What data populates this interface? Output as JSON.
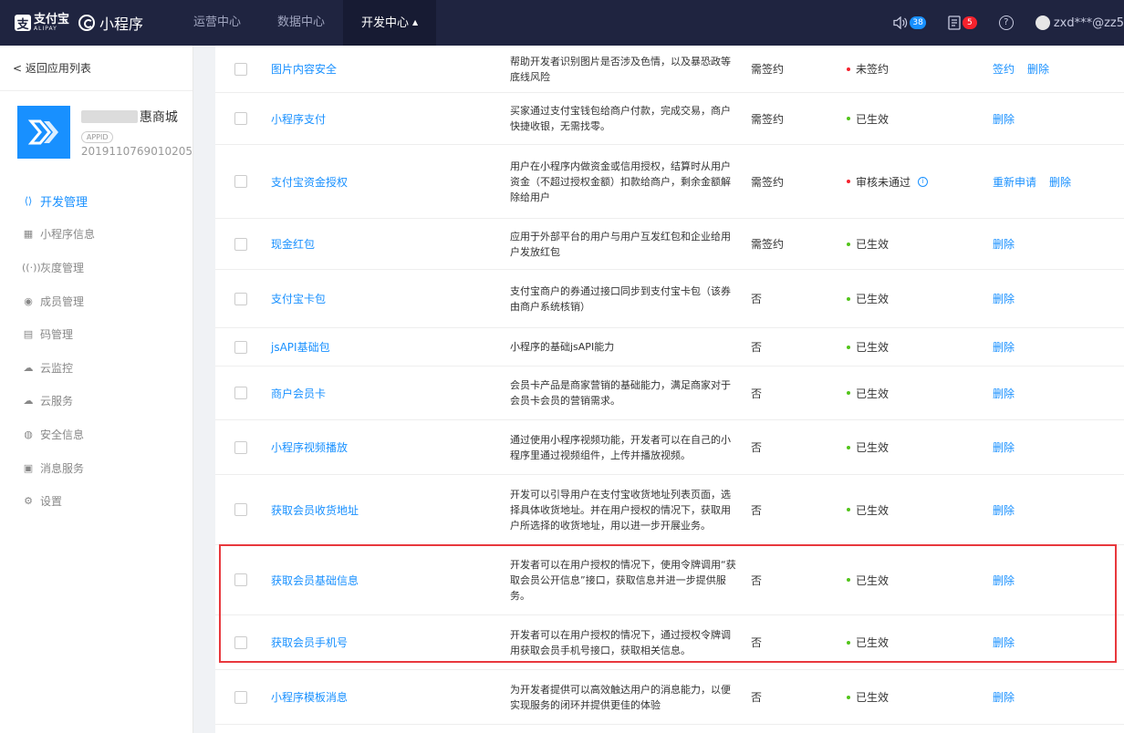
{
  "topnav": {
    "alipay_cn": "支付宝",
    "alipay_en": "ALIPAY",
    "alipay_mark": "支",
    "product": "小程序",
    "tabs": [
      {
        "label": "运营中心"
      },
      {
        "label": "数据中心"
      },
      {
        "label": "开发中心"
      }
    ],
    "active_tab_caret": "▲",
    "notifications_badge": "38",
    "messages_badge": "5",
    "help_glyph": "?",
    "user": "zxd***@zz5"
  },
  "sidebar": {
    "back": "< 返回应用列表",
    "app_name_suffix": "惠商城",
    "appid_tag": "APPID",
    "app_id": "2019110769010205",
    "menu": [
      {
        "label": "开发管理",
        "icon": "code-icon",
        "glyph": "⟨⟩"
      },
      {
        "label": "小程序信息",
        "icon": "grid-icon",
        "glyph": "▦"
      },
      {
        "label": "灰度管理",
        "icon": "signal-icon",
        "glyph": "((·))"
      },
      {
        "label": "成员管理",
        "icon": "user-icon",
        "glyph": "◉"
      },
      {
        "label": "码管理",
        "icon": "qrcode-icon",
        "glyph": "▤"
      },
      {
        "label": "云监控",
        "icon": "cloud-icon",
        "glyph": "☁"
      },
      {
        "label": "云服务",
        "icon": "cloud-service-icon",
        "glyph": "☁"
      },
      {
        "label": "安全信息",
        "icon": "shield-icon",
        "glyph": "◍"
      },
      {
        "label": "消息服务",
        "icon": "message-icon",
        "glyph": "▣"
      },
      {
        "label": "设置",
        "icon": "gear-icon",
        "glyph": "⚙"
      }
    ]
  },
  "table": {
    "rows": [
      {
        "name": "图片内容安全",
        "desc": "帮助开发者识别图片是否涉及色情，以及暴恐政等底线风险",
        "sign": "需签约",
        "status": "未签约",
        "status_color": "#f5222d",
        "actions": [
          "签约",
          "删除"
        ]
      },
      {
        "name": "小程序支付",
        "desc": "买家通过支付宝钱包给商户付款，完成交易，商户快捷收银，无需找零。",
        "sign": "需签约",
        "status": "已生效",
        "status_color": "#52c41a",
        "actions": [
          "删除"
        ]
      },
      {
        "name": "支付宝资金授权",
        "desc": "用户在小程序内做资金或信用授权，结算时从用户资金（不超过授权金额）扣款给商户，剩余金额解除给用户",
        "sign": "需签约",
        "status": "审核未通过",
        "status_color": "#f5222d",
        "info_glyph": "i",
        "actions": [
          "重新申请",
          "删除"
        ]
      },
      {
        "name": "现金红包",
        "desc": "应用于外部平台的用户与用户互发红包和企业给用户发放红包",
        "sign": "需签约",
        "status": "已生效",
        "status_color": "#52c41a",
        "actions": [
          "删除"
        ]
      },
      {
        "name": "支付宝卡包",
        "desc": "支付宝商户的券通过接口同步到支付宝卡包（该券由商户系统核销）",
        "sign": "否",
        "status": "已生效",
        "status_color": "#52c41a",
        "actions": [
          "删除"
        ]
      },
      {
        "name": "jsAPI基础包",
        "desc": "小程序的基础jsAPI能力",
        "sign": "否",
        "status": "已生效",
        "status_color": "#52c41a",
        "actions": [
          "删除"
        ]
      },
      {
        "name": "商户会员卡",
        "desc": "会员卡产品是商家营销的基础能力，满足商家对于会员卡会员的营销需求。",
        "sign": "否",
        "status": "已生效",
        "status_color": "#52c41a",
        "actions": [
          "删除"
        ]
      },
      {
        "name": "小程序视频播放",
        "desc": "通过使用小程序视频功能，开发者可以在自己的小程序里通过视频组件，上传并播放视频。",
        "sign": "否",
        "status": "已生效",
        "status_color": "#52c41a",
        "actions": [
          "删除"
        ]
      },
      {
        "name": "获取会员收货地址",
        "desc": "开发可以引导用户在支付宝收货地址列表页面，选择具体收货地址。并在用户授权的情况下，获取用户所选择的收货地址，用以进一步开展业务。",
        "sign": "否",
        "status": "已生效",
        "status_color": "#52c41a",
        "actions": [
          "删除"
        ]
      },
      {
        "name": "获取会员基础信息",
        "desc": "开发者可以在用户授权的情况下，使用令牌调用“获取会员公开信息”接口，获取信息并进一步提供服务。",
        "sign": "否",
        "status": "已生效",
        "status_color": "#52c41a",
        "actions": [
          "删除"
        ]
      },
      {
        "name": "获取会员手机号",
        "desc": "开发者可以在用户授权的情况下，通过授权令牌调用获取会员手机号接口，获取相关信息。",
        "sign": "否",
        "status": "已生效",
        "status_color": "#52c41a",
        "actions": [
          "删除"
        ]
      },
      {
        "name": "小程序模板消息",
        "desc": "为开发者提供可以高效触达用户的消息能力，以便实现服务的闭环并提供更佳的体验",
        "sign": "否",
        "status": "已生效",
        "status_color": "#52c41a",
        "actions": [
          "删除"
        ]
      }
    ]
  }
}
